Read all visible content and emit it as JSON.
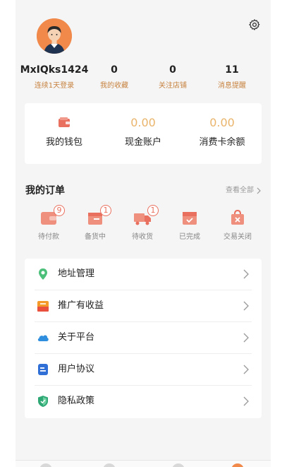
{
  "profile": {
    "username": "MxIQks1424"
  },
  "stats": [
    {
      "value": "",
      "label": "连续1天登录"
    },
    {
      "value": "0",
      "label": "我的收藏"
    },
    {
      "value": "0",
      "label": "关注店铺"
    },
    {
      "value": "11",
      "label": "消息提醒"
    }
  ],
  "wallet": {
    "my_wallet_label": "我的钱包",
    "cash": {
      "value": "0.00",
      "label": "现金账户"
    },
    "card": {
      "value": "0.00",
      "label": "消费卡余额"
    }
  },
  "orders": {
    "title": "我的订单",
    "view_all": "查看全部",
    "items": [
      {
        "label": "待付款",
        "badge": "9",
        "icon": "wallet-pending-icon"
      },
      {
        "label": "备货中",
        "badge": "1",
        "icon": "stock-box-icon"
      },
      {
        "label": "待收货",
        "badge": "1",
        "icon": "truck-icon"
      },
      {
        "label": "已完成",
        "badge": "",
        "icon": "completed-box-icon"
      },
      {
        "label": "交易关闭",
        "badge": "",
        "icon": "closed-bag-icon"
      }
    ]
  },
  "menu": [
    {
      "label": "地址管理",
      "icon": "location-pin-icon"
    },
    {
      "label": "推广有收益",
      "icon": "promotion-icon"
    },
    {
      "label": "关于平台",
      "icon": "cloud-icon"
    },
    {
      "label": "用户协议",
      "icon": "document-icon"
    },
    {
      "label": "隐私政策",
      "icon": "shield-icon"
    }
  ],
  "colors": {
    "accent_red": "#e9705e",
    "gold_label": "#c7823f",
    "wallet_value": "#e9b46a",
    "avatar_bg": "#f0894a"
  }
}
